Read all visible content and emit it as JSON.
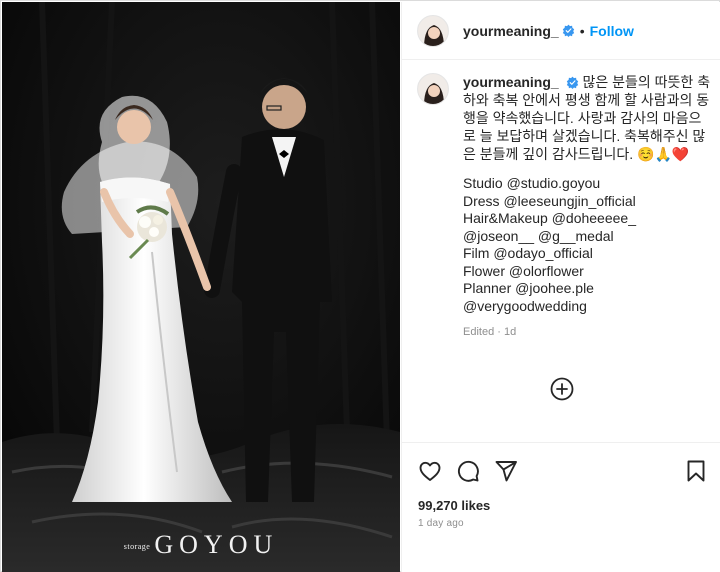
{
  "post": {
    "username": "yourmeaning_",
    "follow_label": "Follow",
    "header_separator": "•",
    "caption_korean": "많은 분들의 따뜻한 축하와 축복 안에서 평생 함께 할 사람과의 동행을 약속했습니다. 사랑과 감사의 마음으로 늘 보답하며 살겠습니다. 축복해주신 많은 분들께 깊이 감사드립니다. ☺️🙏❤️",
    "credits": [
      "Studio @studio.goyou",
      "Dress @leeseungjin_official",
      "Hair&Makeup @doheeeee_",
      "@joseon__ @g__medal",
      "Film @odayo_official",
      "Flower @olorflower",
      "Planner @joohee.ple",
      "@verygoodwedding"
    ],
    "edited": "Edited · 1d",
    "likes": "99,270 likes",
    "time_ago": "1 day ago"
  },
  "photo": {
    "watermark_small": "storage",
    "watermark_big": "GOYOU"
  },
  "icons": {
    "verified": "verified-badge-icon",
    "more": "plus-circle-icon",
    "like": "heart-icon",
    "comment": "comment-icon",
    "share": "send-icon",
    "save": "bookmark-icon"
  },
  "colors": {
    "link": "#0095f6",
    "verified": "#3897f0",
    "muted": "#8e8e8e",
    "text": "#262626"
  }
}
